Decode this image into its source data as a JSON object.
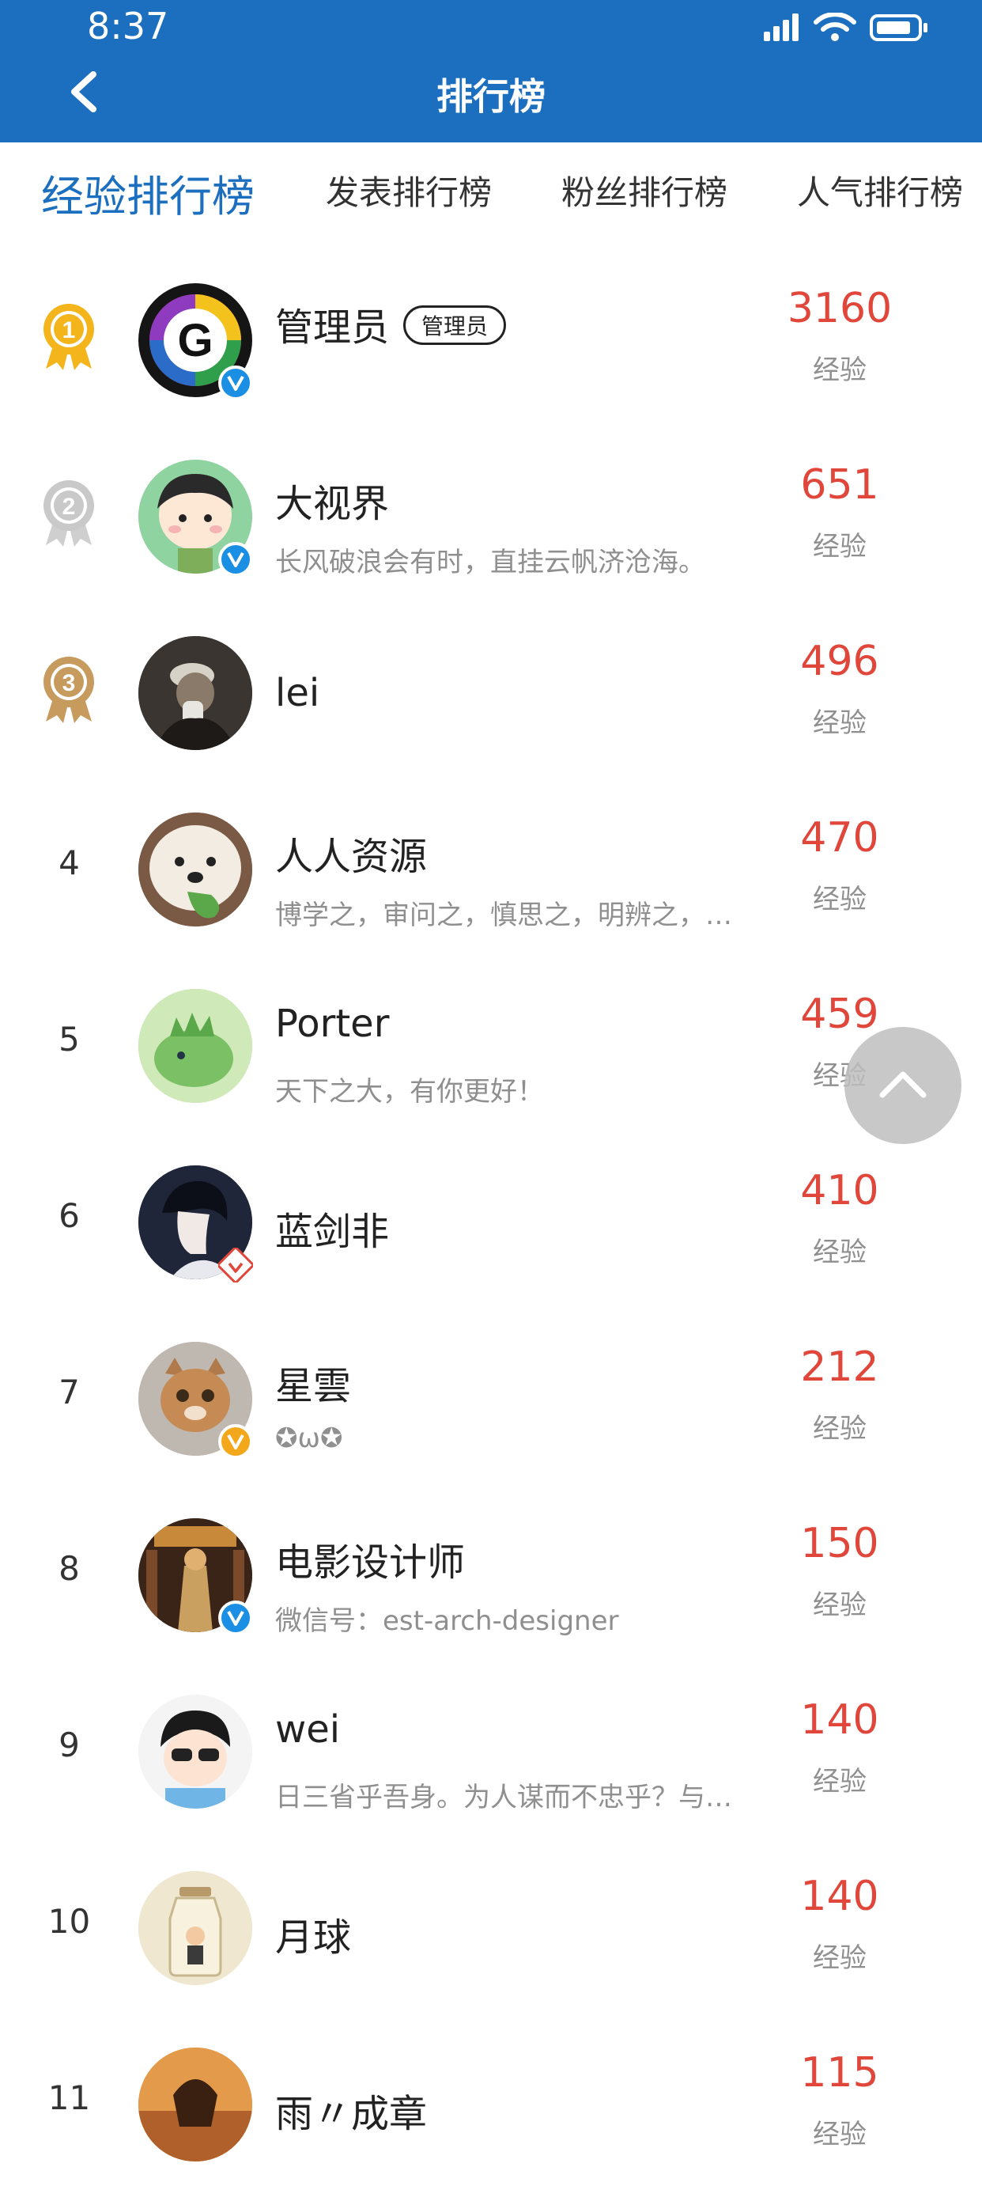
{
  "status": {
    "time": "8:37"
  },
  "header": {
    "title": "排行榜"
  },
  "tabs": [
    {
      "label": "经验排行榜",
      "active": true
    },
    {
      "label": "发表排行榜",
      "active": false
    },
    {
      "label": "粉丝排行榜",
      "active": false
    },
    {
      "label": "人气排行榜",
      "active": false
    }
  ],
  "rows": [
    {
      "rank": "1",
      "name": "管理员",
      "tag": "管理员",
      "signature": "",
      "score": "3160",
      "score_label": "经验"
    },
    {
      "rank": "2",
      "name": "大视界",
      "signature": "长风破浪会有时，直挂云帆济沧海。",
      "score": "651",
      "score_label": "经验"
    },
    {
      "rank": "3",
      "name": "lei",
      "signature": "",
      "score": "496",
      "score_label": "经验"
    },
    {
      "rank": "4",
      "name": "人人资源",
      "signature": "博学之，审问之，慎思之，明辨之，…",
      "score": "470",
      "score_label": "经验"
    },
    {
      "rank": "5",
      "name": "Porter",
      "signature": "天下之大，有你更好！",
      "score": "459",
      "score_label": "经验"
    },
    {
      "rank": "6",
      "name": "蓝剑非",
      "signature": "",
      "score": "410",
      "score_label": "经验"
    },
    {
      "rank": "7",
      "name": "星雲",
      "signature": "✪ω✪",
      "score": "212",
      "score_label": "经验"
    },
    {
      "rank": "8",
      "name": "电影设计师",
      "signature": "微信号：est-arch-designer",
      "score": "150",
      "score_label": "经验"
    },
    {
      "rank": "9",
      "name": "wei",
      "signature": "日三省乎吾身。为人谋而不忠乎？与…",
      "score": "140",
      "score_label": "经验"
    },
    {
      "rank": "10",
      "name": "月球",
      "signature": "",
      "score": "140",
      "score_label": "经验"
    },
    {
      "rank": "11",
      "name": "雨〃成章",
      "signature": "",
      "score": "115",
      "score_label": "经验"
    }
  ],
  "colors": {
    "header": "#1c6fbf",
    "score": "#e0463a",
    "gold": "#f3b51b",
    "silver": "#c9c9c9",
    "bronze": "#c79a5d",
    "verify": "#1a8fe3"
  },
  "icons": [
    "signal-icon",
    "wifi-icon",
    "battery-icon",
    "back-arrow-icon",
    "medal-icon",
    "verified-badge-icon",
    "scroll-top-icon"
  ]
}
